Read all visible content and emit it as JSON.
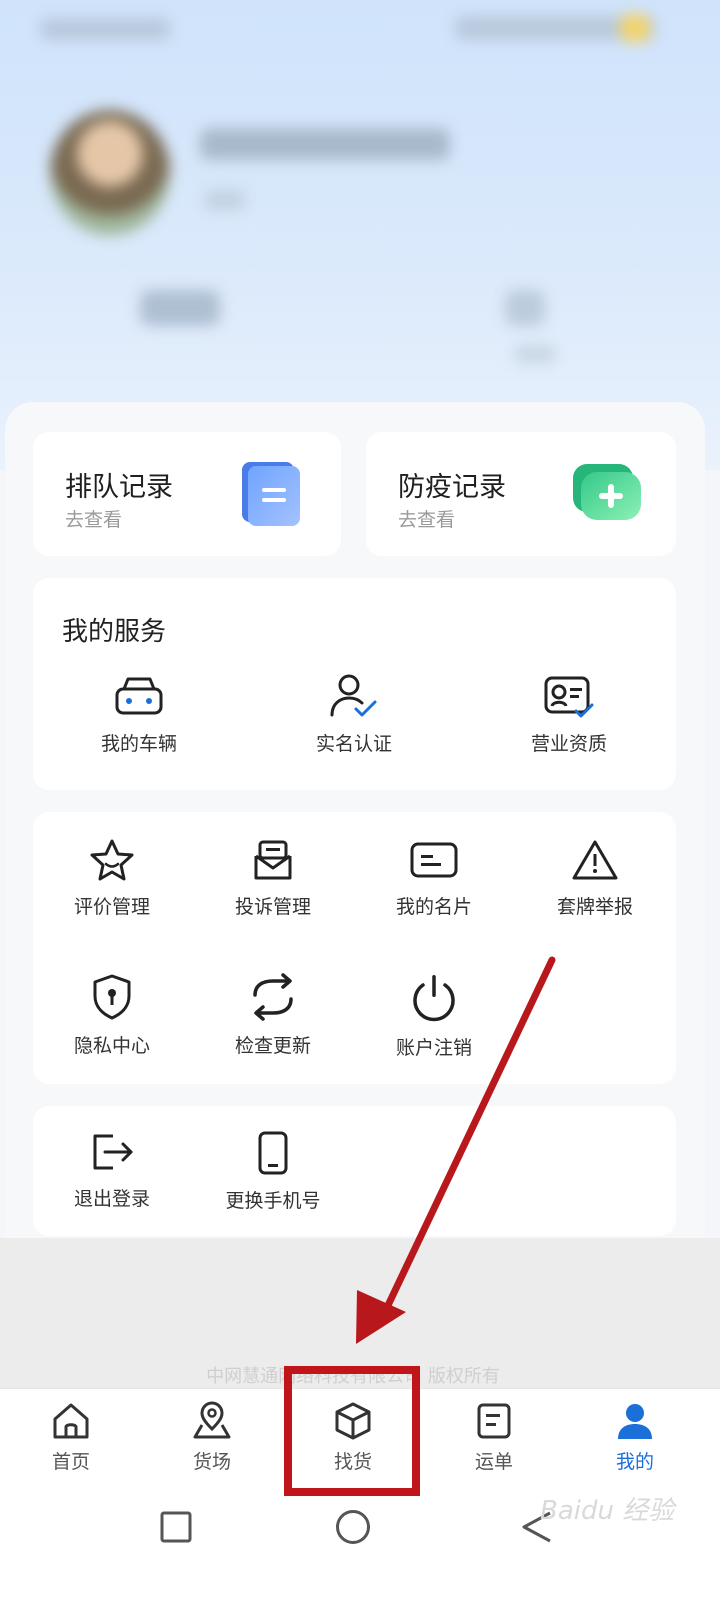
{
  "records": [
    {
      "title": "排队记录",
      "subtitle": "去查看",
      "icon": "document-icon"
    },
    {
      "title": "防疫记录",
      "subtitle": "去查看",
      "icon": "shield-plus-icon"
    }
  ],
  "my_services": {
    "title": "我的服务",
    "items": [
      {
        "label": "我的车辆",
        "icon": "vehicle-icon"
      },
      {
        "label": "实名认证",
        "icon": "user-check-icon"
      },
      {
        "label": "营业资质",
        "icon": "license-check-icon"
      }
    ]
  },
  "tools": [
    {
      "label": "评价管理",
      "icon": "star-icon"
    },
    {
      "label": "投诉管理",
      "icon": "mail-icon"
    },
    {
      "label": "我的名片",
      "icon": "card-icon"
    },
    {
      "label": "套牌举报",
      "icon": "warning-icon"
    },
    {
      "label": "隐私中心",
      "icon": "shield-keyhole-icon"
    },
    {
      "label": "检查更新",
      "icon": "refresh-icon"
    },
    {
      "label": "账户注销",
      "icon": "power-icon"
    }
  ],
  "account": [
    {
      "label": "退出登录",
      "icon": "logout-icon"
    },
    {
      "label": "更换手机号",
      "icon": "phone-icon"
    }
  ],
  "copyright": "中网慧通网络科技有限公司 版权所有",
  "tabs": [
    {
      "label": "首页",
      "icon": "home-icon"
    },
    {
      "label": "货场",
      "icon": "map-pin-icon"
    },
    {
      "label": "找货",
      "icon": "box-icon"
    },
    {
      "label": "运单",
      "icon": "waybill-icon"
    },
    {
      "label": "我的",
      "icon": "person-icon",
      "active": true
    }
  ],
  "watermark": "Baidu 经验",
  "colors": {
    "accent": "#1a6fd8",
    "annotation_red": "#c0161b"
  }
}
